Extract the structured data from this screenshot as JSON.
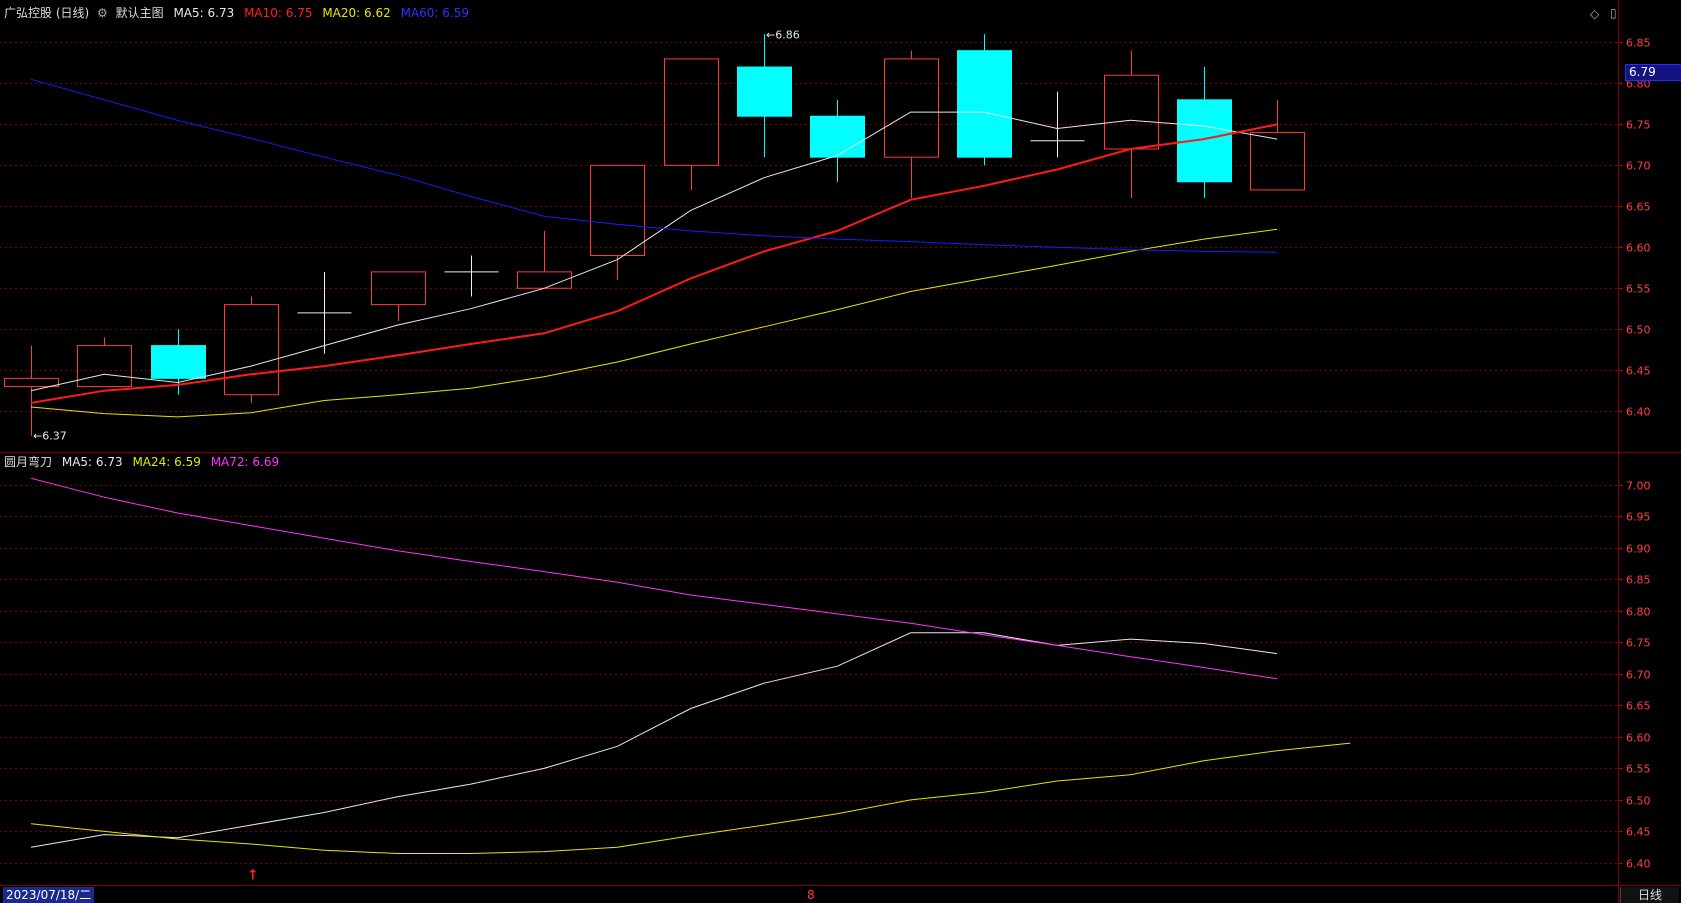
{
  "header_top": {
    "stock_name": "广弘控股 (日线)",
    "main_label": "默认主图",
    "ma5": "MA5: 6.73",
    "ma10": "MA10: 6.75",
    "ma20": "MA20: 6.62",
    "ma60": "MA60: 6.59"
  },
  "header_bottom": {
    "indicator_name": "圆月弯刀",
    "ma5": "MA5: 6.73",
    "ma24": "MA24: 6.59",
    "ma72": "MA72: 6.69"
  },
  "footer": {
    "date": "2023/07/18/二",
    "mid_mark": "8",
    "mode": "日线"
  },
  "current_price": "6.79",
  "colors": {
    "up": "#ff3a3a",
    "down": "#00ffff",
    "ma5": "#e8e8e8",
    "ma10": "#ff1a1a",
    "ma20": "#e6e600",
    "ma60": "#1a1aff",
    "ma24": "#e6e600",
    "ma72": "#ff33ff",
    "grid": "#7a0000"
  },
  "chart_data": [
    {
      "type": "candlestick",
      "name_label": "默认主图",
      "ylim": [
        6.355,
        6.875
      ],
      "yticks": [
        "6.85",
        "6.80",
        "6.75",
        "6.70",
        "6.65",
        "6.60",
        "6.55",
        "6.50",
        "6.45",
        "6.40"
      ],
      "candles": [
        {
          "o": 6.43,
          "h": 6.48,
          "l": 6.37,
          "c": 6.44
        },
        {
          "o": 6.43,
          "h": 6.49,
          "l": 6.43,
          "c": 6.48
        },
        {
          "o": 6.48,
          "h": 6.5,
          "l": 6.42,
          "c": 6.44
        },
        {
          "o": 6.42,
          "h": 6.54,
          "l": 6.41,
          "c": 6.53
        },
        {
          "o": 6.52,
          "h": 6.57,
          "l": 6.47,
          "c": 6.52
        },
        {
          "o": 6.53,
          "h": 6.57,
          "l": 6.51,
          "c": 6.57
        },
        {
          "o": 6.57,
          "h": 6.59,
          "l": 6.54,
          "c": 6.57
        },
        {
          "o": 6.55,
          "h": 6.62,
          "l": 6.55,
          "c": 6.57
        },
        {
          "o": 6.59,
          "h": 6.7,
          "l": 6.56,
          "c": 6.7
        },
        {
          "o": 6.7,
          "h": 6.83,
          "l": 6.67,
          "c": 6.83
        },
        {
          "o": 6.82,
          "h": 6.86,
          "l": 6.71,
          "c": 6.76
        },
        {
          "o": 6.76,
          "h": 6.78,
          "l": 6.68,
          "c": 6.71
        },
        {
          "o": 6.71,
          "h": 6.84,
          "l": 6.66,
          "c": 6.83
        },
        {
          "o": 6.84,
          "h": 6.86,
          "l": 6.7,
          "c": 6.71
        },
        {
          "o": 6.73,
          "h": 6.79,
          "l": 6.71,
          "c": 6.73
        },
        {
          "o": 6.72,
          "h": 6.84,
          "l": 6.66,
          "c": 6.81
        },
        {
          "o": 6.78,
          "h": 6.82,
          "l": 6.66,
          "c": 6.68
        },
        {
          "o": 6.67,
          "h": 6.78,
          "l": 6.67,
          "c": 6.74
        }
      ],
      "series": [
        {
          "name": "MA5",
          "color_key": "ma5",
          "values": [
            6.425,
            6.445,
            6.435,
            6.455,
            6.48,
            6.505,
            6.525,
            6.55,
            6.585,
            6.645,
            6.685,
            6.712,
            6.765,
            6.765,
            6.745,
            6.755,
            6.748,
            6.732
          ]
        },
        {
          "name": "MA10",
          "color_key": "ma10",
          "values": [
            6.41,
            6.425,
            6.432,
            6.445,
            6.455,
            6.468,
            6.482,
            6.495,
            6.522,
            6.562,
            6.595,
            6.62,
            6.658,
            6.675,
            6.695,
            6.72,
            6.732,
            6.75
          ]
        },
        {
          "name": "MA20",
          "color_key": "ma20",
          "values": [
            6.405,
            6.397,
            6.393,
            6.398,
            6.413,
            6.42,
            6.428,
            6.442,
            6.46,
            6.482,
            6.503,
            6.524,
            6.546,
            6.562,
            6.578,
            6.595,
            6.61,
            6.622
          ]
        },
        {
          "name": "MA60",
          "color_key": "ma60",
          "values": [
            6.805,
            6.78,
            6.755,
            6.733,
            6.71,
            6.688,
            6.662,
            6.638,
            6.628,
            6.62,
            6.614,
            6.61,
            6.607,
            6.603,
            6.6,
            6.597,
            6.595,
            6.594
          ]
        }
      ],
      "annotations": [
        {
          "text": "6.86",
          "candle": 10,
          "value": 6.86
        },
        {
          "text": "6.37",
          "candle": 0,
          "value": 6.37
        }
      ]
    },
    {
      "type": "line",
      "name_label": "圆月弯刀",
      "ylim": [
        6.365,
        7.02
      ],
      "yticks": [
        "7.00",
        "6.95",
        "6.90",
        "6.85",
        "6.80",
        "6.75",
        "6.70",
        "6.65",
        "6.60",
        "6.55",
        "6.50",
        "6.45",
        "6.40"
      ],
      "series": [
        {
          "name": "MA5",
          "color_key": "ma5",
          "values": [
            6.425,
            6.445,
            6.44,
            6.46,
            6.48,
            6.505,
            6.525,
            6.55,
            6.585,
            6.645,
            6.685,
            6.712,
            6.765,
            6.765,
            6.745,
            6.755,
            6.748,
            6.732
          ]
        },
        {
          "name": "MA24",
          "color_key": "ma24",
          "values": [
            6.462,
            6.45,
            6.438,
            6.43,
            6.42,
            6.415,
            6.415,
            6.418,
            6.425,
            6.443,
            6.46,
            6.478,
            6.5,
            6.512,
            6.53,
            6.54,
            6.562,
            6.578,
            6.59
          ]
        },
        {
          "name": "MA72",
          "color_key": "ma72",
          "values": [
            7.01,
            6.98,
            6.955,
            6.935,
            6.915,
            6.895,
            6.878,
            6.862,
            6.845,
            6.825,
            6.81,
            6.795,
            6.78,
            6.762,
            6.745,
            6.727,
            6.71,
            6.692
          ]
        }
      ],
      "annotations": [
        {
          "text": "↑",
          "candle": 3,
          "value": 6.38
        }
      ]
    }
  ]
}
